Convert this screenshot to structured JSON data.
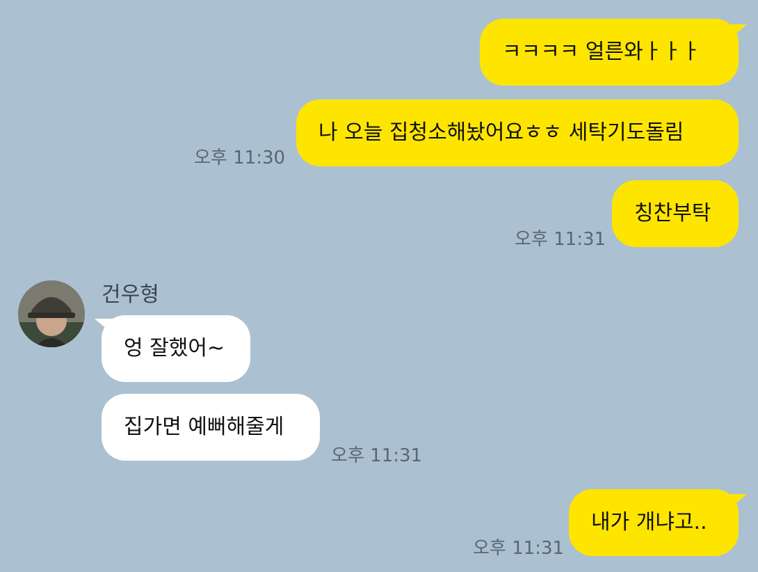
{
  "chat": {
    "messages": [
      {
        "side": "mine",
        "text": "ㅋㅋㅋㅋ 얼른와ㅏㅏㅏ",
        "time": ""
      },
      {
        "side": "mine",
        "text": "나 오늘 집청소해놨어요ㅎㅎ 세탁기도돌림",
        "time": "오후 11:30"
      },
      {
        "side": "mine",
        "text": "칭찬부탁",
        "time": "오후 11:31"
      },
      {
        "side": "theirs",
        "text": "엉 잘했어~",
        "time": ""
      },
      {
        "side": "theirs",
        "text": "집가면 예뻐해줄게",
        "time": "오후 11:31"
      },
      {
        "side": "mine",
        "text": "내가 개냐고..",
        "time": "오후 11:31"
      }
    ],
    "sender": {
      "name": "건우형",
      "avatar": "profile-photo"
    }
  },
  "colors": {
    "background": "#abc1d1",
    "my_bubble": "#fee500",
    "their_bubble": "#ffffff",
    "time_text": "#5a6670"
  }
}
